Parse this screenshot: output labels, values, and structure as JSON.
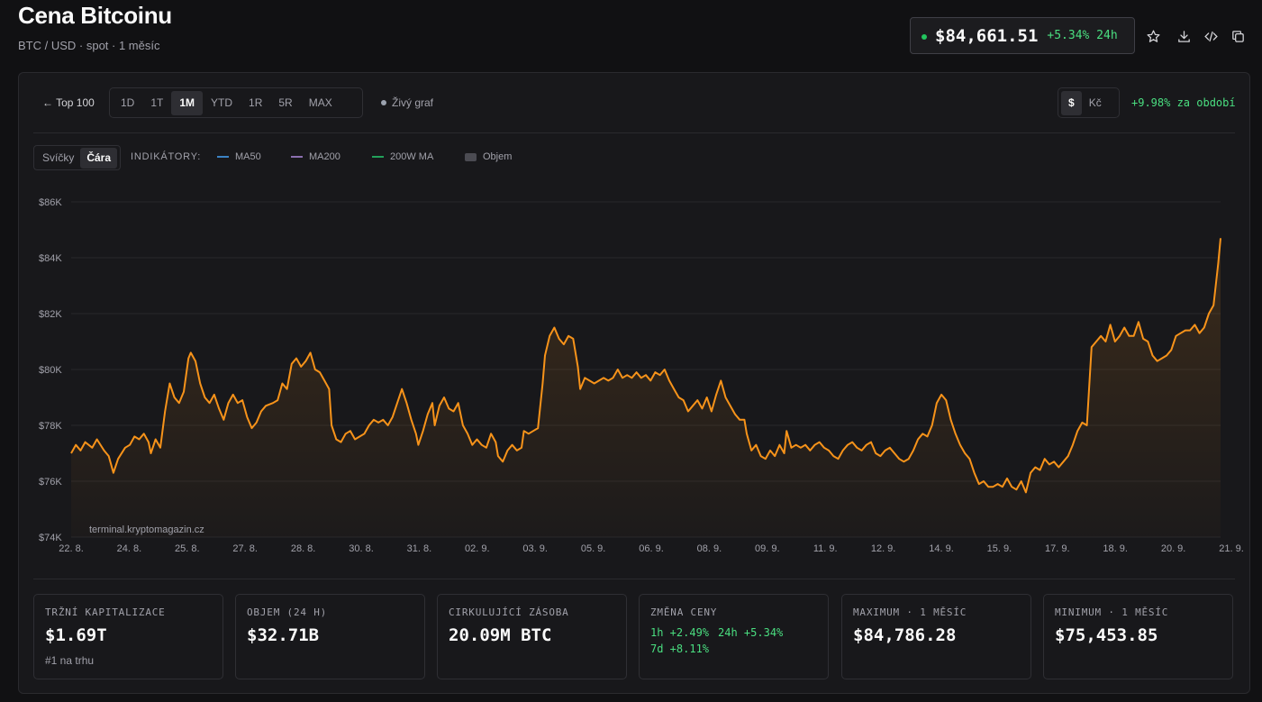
{
  "header": {
    "title": "Cena Bitcoinu",
    "subtitle": "BTC / USD · spot · 1 měsíc",
    "price": "$84,661.51",
    "price_change": "+5.34% 24h",
    "live_color": "#22c55e",
    "icons": [
      "star-icon",
      "download-icon",
      "code-icon",
      "copy-icon"
    ]
  },
  "toolbar": {
    "back_label": "← Top 100",
    "ranges": [
      "1D",
      "1T",
      "1M",
      "YTD",
      "1R",
      "5R",
      "MAX"
    ],
    "active_range": "1M",
    "live_label": "Živý graf",
    "currencies": [
      "$",
      "Kč"
    ],
    "active_currency": "$",
    "period_change": "+9.98% za období"
  },
  "chart_controls": {
    "types": [
      "Svíčky",
      "Čára"
    ],
    "active_type": "Čára",
    "indicators_label": "INDIKÁTORY:",
    "indicators": [
      {
        "name": "MA50",
        "color": "#3b82c4",
        "style": "line"
      },
      {
        "name": "MA200",
        "color": "#8b6fb0",
        "style": "line"
      },
      {
        "name": "200W MA",
        "color": "#22a05a",
        "style": "line"
      },
      {
        "name": "Objem",
        "color": "#4b4b52",
        "style": "box"
      }
    ]
  },
  "chart_data": {
    "type": "line",
    "ylim": [
      74000,
      86000
    ],
    "y_ticks": [
      74000,
      76000,
      78000,
      80000,
      82000,
      84000,
      86000
    ],
    "y_tick_labels": [
      "$74K",
      "$76K",
      "$78K",
      "$80K",
      "$82K",
      "$84K",
      "$86K"
    ],
    "x_tick_labels": [
      "22. 8.",
      "24. 8.",
      "25. 8.",
      "27. 8.",
      "28. 8.",
      "30. 8.",
      "31. 8.",
      "02. 9.",
      "03. 9.",
      "05. 9.",
      "06. 9.",
      "08. 9.",
      "09. 9.",
      "11. 9.",
      "12. 9.",
      "14. 9.",
      "15. 9.",
      "17. 9.",
      "18. 9.",
      "20. 9.",
      "21. 9."
    ],
    "grid": true,
    "line_color": "#f7931a",
    "watermark": "terminal.kryptomagazin.cz",
    "series": [
      {
        "points": [
          [
            0.0,
            77000
          ],
          [
            0.2,
            77300
          ],
          [
            0.4,
            77100
          ],
          [
            0.6,
            77400
          ],
          [
            0.9,
            77200
          ],
          [
            1.1,
            77500
          ],
          [
            1.4,
            77100
          ],
          [
            1.6,
            76900
          ],
          [
            1.8,
            76300
          ],
          [
            2.0,
            76800
          ],
          [
            2.3,
            77200
          ],
          [
            2.5,
            77300
          ],
          [
            2.7,
            77600
          ],
          [
            2.9,
            77500
          ],
          [
            3.1,
            77700
          ],
          [
            3.3,
            77400
          ],
          [
            3.4,
            77000
          ],
          [
            3.6,
            77500
          ],
          [
            3.8,
            77200
          ],
          [
            4.0,
            78500
          ],
          [
            4.2,
            79500
          ],
          [
            4.4,
            79000
          ],
          [
            4.6,
            78800
          ],
          [
            4.8,
            79200
          ],
          [
            5.0,
            80400
          ],
          [
            5.1,
            80600
          ],
          [
            5.3,
            80300
          ],
          [
            5.5,
            79500
          ],
          [
            5.7,
            79000
          ],
          [
            5.9,
            78800
          ],
          [
            6.1,
            79100
          ],
          [
            6.3,
            78600
          ],
          [
            6.5,
            78200
          ],
          [
            6.7,
            78800
          ],
          [
            6.9,
            79100
          ],
          [
            7.1,
            78800
          ],
          [
            7.3,
            78900
          ],
          [
            7.5,
            78300
          ],
          [
            7.7,
            77900
          ],
          [
            7.9,
            78100
          ],
          [
            8.1,
            78500
          ],
          [
            8.3,
            78700
          ],
          [
            8.6,
            78800
          ],
          [
            8.8,
            78900
          ],
          [
            9.0,
            79500
          ],
          [
            9.2,
            79300
          ],
          [
            9.4,
            80200
          ],
          [
            9.6,
            80400
          ],
          [
            9.8,
            80100
          ],
          [
            10.0,
            80300
          ],
          [
            10.2,
            80600
          ],
          [
            10.4,
            80000
          ],
          [
            10.6,
            79900
          ],
          [
            10.8,
            79600
          ],
          [
            11.0,
            79300
          ],
          [
            11.1,
            78000
          ],
          [
            11.3,
            77500
          ],
          [
            11.5,
            77400
          ],
          [
            11.7,
            77700
          ],
          [
            11.9,
            77800
          ],
          [
            12.1,
            77500
          ],
          [
            12.3,
            77600
          ],
          [
            12.5,
            77700
          ],
          [
            12.7,
            78000
          ],
          [
            12.9,
            78200
          ],
          [
            13.1,
            78100
          ],
          [
            13.3,
            78200
          ],
          [
            13.5,
            78000
          ],
          [
            13.7,
            78300
          ],
          [
            13.9,
            78800
          ],
          [
            14.1,
            79300
          ],
          [
            14.3,
            78800
          ],
          [
            14.5,
            78200
          ],
          [
            14.7,
            77700
          ],
          [
            14.8,
            77300
          ],
          [
            15.0,
            77800
          ],
          [
            15.2,
            78400
          ],
          [
            15.4,
            78800
          ],
          [
            15.5,
            78000
          ],
          [
            15.7,
            78700
          ],
          [
            15.9,
            79000
          ],
          [
            16.1,
            78600
          ],
          [
            16.3,
            78500
          ],
          [
            16.5,
            78800
          ],
          [
            16.7,
            78000
          ],
          [
            16.9,
            77700
          ],
          [
            17.1,
            77300
          ],
          [
            17.3,
            77500
          ],
          [
            17.5,
            77300
          ],
          [
            17.7,
            77200
          ],
          [
            17.9,
            77700
          ],
          [
            18.1,
            77400
          ],
          [
            18.2,
            76900
          ],
          [
            18.4,
            76700
          ],
          [
            18.6,
            77100
          ],
          [
            18.8,
            77300
          ],
          [
            19.0,
            77100
          ],
          [
            19.2,
            77200
          ],
          [
            19.3,
            77800
          ],
          [
            19.5,
            77700
          ],
          [
            19.7,
            77800
          ],
          [
            19.9,
            77900
          ],
          [
            20.1,
            79500
          ],
          [
            20.2,
            80500
          ],
          [
            20.4,
            81200
          ],
          [
            20.6,
            81500
          ],
          [
            20.8,
            81100
          ],
          [
            21.0,
            80900
          ],
          [
            21.2,
            81200
          ],
          [
            21.4,
            81100
          ],
          [
            21.6,
            80100
          ],
          [
            21.7,
            79300
          ],
          [
            21.9,
            79700
          ],
          [
            22.1,
            79600
          ],
          [
            22.3,
            79500
          ],
          [
            22.5,
            79600
          ],
          [
            22.7,
            79700
          ],
          [
            22.9,
            79600
          ],
          [
            23.1,
            79700
          ],
          [
            23.3,
            80000
          ],
          [
            23.5,
            79700
          ],
          [
            23.7,
            79800
          ],
          [
            23.9,
            79700
          ],
          [
            24.1,
            79900
          ],
          [
            24.3,
            79700
          ],
          [
            24.5,
            79800
          ],
          [
            24.7,
            79600
          ],
          [
            24.9,
            79900
          ],
          [
            25.1,
            79800
          ],
          [
            25.3,
            80000
          ],
          [
            25.5,
            79600
          ],
          [
            25.7,
            79300
          ],
          [
            25.9,
            79000
          ],
          [
            26.1,
            78900
          ],
          [
            26.3,
            78500
          ],
          [
            26.5,
            78700
          ],
          [
            26.7,
            78900
          ],
          [
            26.9,
            78600
          ],
          [
            27.1,
            79000
          ],
          [
            27.3,
            78500
          ],
          [
            27.5,
            79100
          ],
          [
            27.7,
            79600
          ],
          [
            27.9,
            79000
          ],
          [
            28.1,
            78700
          ],
          [
            28.3,
            78400
          ],
          [
            28.5,
            78200
          ],
          [
            28.7,
            78200
          ],
          [
            28.8,
            77700
          ],
          [
            29.0,
            77100
          ],
          [
            29.2,
            77300
          ],
          [
            29.4,
            76900
          ],
          [
            29.6,
            76800
          ],
          [
            29.8,
            77100
          ],
          [
            30.0,
            76900
          ],
          [
            30.2,
            77300
          ],
          [
            30.4,
            77000
          ],
          [
            30.5,
            77800
          ],
          [
            30.7,
            77200
          ],
          [
            30.9,
            77300
          ],
          [
            31.1,
            77200
          ],
          [
            31.3,
            77300
          ],
          [
            31.5,
            77100
          ],
          [
            31.7,
            77300
          ],
          [
            31.9,
            77400
          ],
          [
            32.1,
            77200
          ],
          [
            32.3,
            77100
          ],
          [
            32.5,
            76900
          ],
          [
            32.7,
            76800
          ],
          [
            32.9,
            77100
          ],
          [
            33.1,
            77300
          ],
          [
            33.3,
            77400
          ],
          [
            33.5,
            77200
          ],
          [
            33.7,
            77100
          ],
          [
            33.9,
            77300
          ],
          [
            34.1,
            77400
          ],
          [
            34.3,
            77000
          ],
          [
            34.5,
            76900
          ],
          [
            34.7,
            77100
          ],
          [
            34.9,
            77200
          ],
          [
            35.1,
            77000
          ],
          [
            35.3,
            76800
          ],
          [
            35.5,
            76700
          ],
          [
            35.7,
            76800
          ],
          [
            35.9,
            77100
          ],
          [
            36.1,
            77500
          ],
          [
            36.3,
            77700
          ],
          [
            36.5,
            77600
          ],
          [
            36.7,
            78000
          ],
          [
            36.9,
            78800
          ],
          [
            37.1,
            79100
          ],
          [
            37.3,
            78900
          ],
          [
            37.5,
            78200
          ],
          [
            37.7,
            77700
          ],
          [
            37.9,
            77300
          ],
          [
            38.1,
            77000
          ],
          [
            38.3,
            76800
          ],
          [
            38.5,
            76300
          ],
          [
            38.7,
            75900
          ],
          [
            38.9,
            76000
          ],
          [
            39.1,
            75800
          ],
          [
            39.3,
            75800
          ],
          [
            39.5,
            75900
          ],
          [
            39.7,
            75800
          ],
          [
            39.9,
            76100
          ],
          [
            40.1,
            75800
          ],
          [
            40.3,
            75700
          ],
          [
            40.5,
            76000
          ],
          [
            40.7,
            75600
          ],
          [
            40.9,
            76300
          ],
          [
            41.1,
            76500
          ],
          [
            41.3,
            76400
          ],
          [
            41.5,
            76800
          ],
          [
            41.7,
            76600
          ],
          [
            41.9,
            76700
          ],
          [
            42.1,
            76500
          ],
          [
            42.3,
            76700
          ],
          [
            42.5,
            76900
          ],
          [
            42.7,
            77300
          ],
          [
            42.9,
            77800
          ],
          [
            43.1,
            78100
          ],
          [
            43.3,
            78000
          ],
          [
            43.5,
            80800
          ],
          [
            43.7,
            81000
          ],
          [
            43.9,
            81200
          ],
          [
            44.1,
            81000
          ],
          [
            44.3,
            81600
          ],
          [
            44.5,
            81000
          ],
          [
            44.7,
            81200
          ],
          [
            44.9,
            81500
          ],
          [
            45.1,
            81200
          ],
          [
            45.3,
            81200
          ],
          [
            45.5,
            81700
          ],
          [
            45.7,
            81100
          ],
          [
            45.9,
            81000
          ],
          [
            46.1,
            80500
          ],
          [
            46.3,
            80300
          ],
          [
            46.5,
            80400
          ],
          [
            46.7,
            80500
          ],
          [
            46.9,
            80700
          ],
          [
            47.1,
            81200
          ],
          [
            47.3,
            81300
          ],
          [
            47.5,
            81400
          ],
          [
            47.7,
            81400
          ],
          [
            47.9,
            81600
          ],
          [
            48.1,
            81300
          ],
          [
            48.3,
            81500
          ],
          [
            48.5,
            82000
          ],
          [
            48.7,
            82300
          ],
          [
            48.9,
            83800
          ],
          [
            49.0,
            84700
          ]
        ]
      }
    ]
  },
  "stats": [
    {
      "label": "Tržní kapitalizace",
      "value": "$1.69T",
      "note": "#1 na trhu"
    },
    {
      "label": "Objem (24 h)",
      "value": "$32.71B"
    },
    {
      "label": "Cirkulující zásoba",
      "value": "20.09M BTC"
    },
    {
      "label": "Změna ceny",
      "changes": [
        "1h +2.49%",
        "24h +5.34%",
        "7d +8.11%"
      ]
    },
    {
      "label": "Maximum · 1 měsíc",
      "value": "$84,786.28"
    },
    {
      "label": "Minimum · 1 měsíc",
      "value": "$75,453.85"
    }
  ]
}
